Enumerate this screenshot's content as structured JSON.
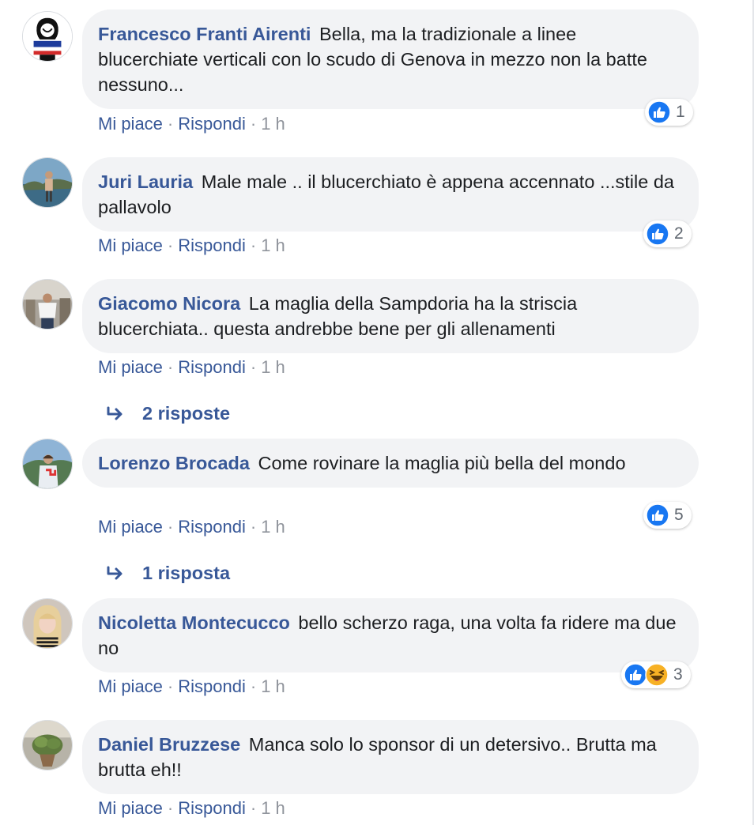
{
  "actions": {
    "like_label": "Mi piace",
    "reply_label": "Rispondi",
    "separator": "·"
  },
  "colors": {
    "link": "#385898",
    "bubble": "#f2f3f5",
    "muted": "#90949c",
    "like_blue": "#1877f2",
    "haha_yellow": "#f7b125"
  },
  "comments": [
    {
      "author": "Francesco Franti Airenti",
      "text": "Bella, ma la tradizionale a linee blucerchiate verticali con lo scudo di Genova in mezzo non la batte nessuno...",
      "time": "1 h",
      "reaction_icons": [
        "like-icon"
      ],
      "reaction_count": "1"
    },
    {
      "author": "Juri Lauria",
      "text": "Male male .. il blucerchiato è appena accennato ...stile da pallavolo",
      "time": "1 h",
      "reaction_icons": [
        "like-icon"
      ],
      "reaction_count": "2"
    },
    {
      "author": "Giacomo Nicora",
      "text": "La maglia della Sampdoria ha la striscia blucerchiata.. questa andrebbe bene per gli allenamenti",
      "time": "1 h",
      "replies_label": "2 risposte"
    },
    {
      "author": "Lorenzo Brocada",
      "text": "Come rovinare la maglia più bella del mondo",
      "time": "1 h",
      "reaction_icons": [
        "like-icon"
      ],
      "reaction_count": "5",
      "replies_label": "1 risposta"
    },
    {
      "author": "Nicoletta Montecucco",
      "text": "bello scherzo raga, una volta fa ridere ma due no",
      "time": "1 h",
      "reaction_icons": [
        "like-icon",
        "haha-icon"
      ],
      "reaction_count": "3"
    },
    {
      "author": "Daniel Bruzzese",
      "text": "Manca solo lo sponsor di un detersivo.. Brutta ma brutta eh!!",
      "time": "1 h"
    }
  ]
}
